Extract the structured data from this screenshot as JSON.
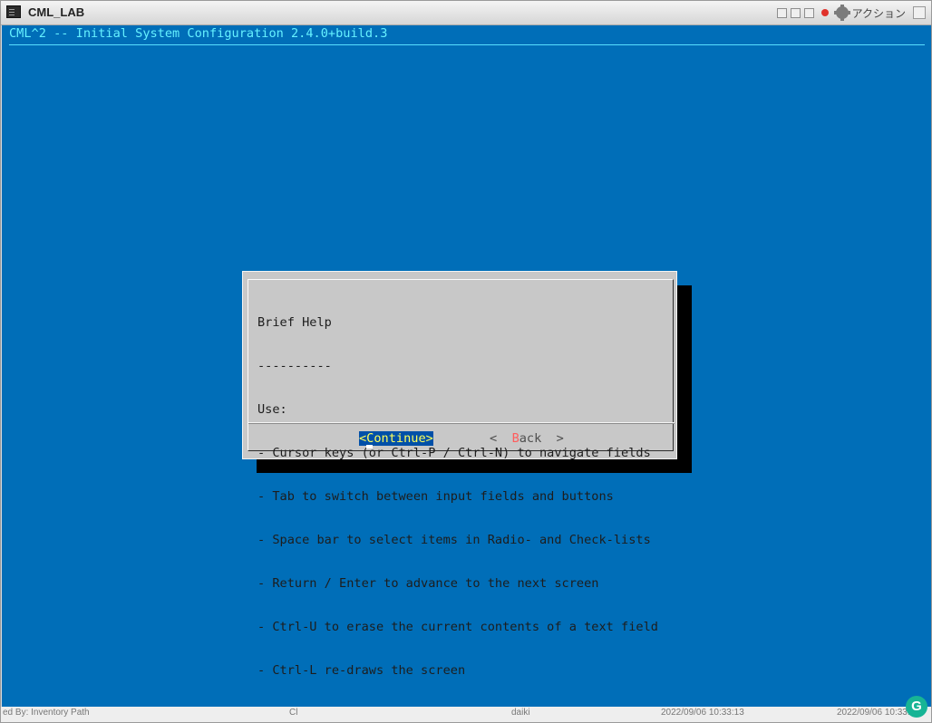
{
  "window": {
    "title": "CML_LAB",
    "action_label": "アクション"
  },
  "terminal": {
    "header": "CML^2 -- Initial System Configuration 2.4.0+build.3"
  },
  "dialog": {
    "lines": [
      "Brief Help",
      "----------",
      "Use:",
      "- Cursor keys (or Ctrl-P / Ctrl-N) to navigate fields",
      "- Tab to switch between input fields and buttons",
      "- Space bar to select items in Radio- and Check-lists",
      "- Return / Enter to advance to the next screen",
      "- Ctrl-U to erase the current contents of a text field",
      "- Ctrl-L re-draws the screen"
    ],
    "continue_button": "<Continue>",
    "back_button": {
      "prefix": "<  ",
      "hotkey": "B",
      "rest": "ack  >"
    }
  },
  "bottom_strip": [
    "ed By: Inventory Path",
    "Cl",
    "daiki",
    "2022/09/06 10:33:13",
    "2022/09/06 10:33:13"
  ],
  "badge": "G",
  "colors": {
    "terminal_bg": "#006eb8",
    "dialog_bg": "#c8c8c8",
    "header_text": "#65f0ff",
    "button_highlight": "#0050a8",
    "button_highlight_text": "#ffff5b",
    "hotkey": "#ff5d5d"
  }
}
